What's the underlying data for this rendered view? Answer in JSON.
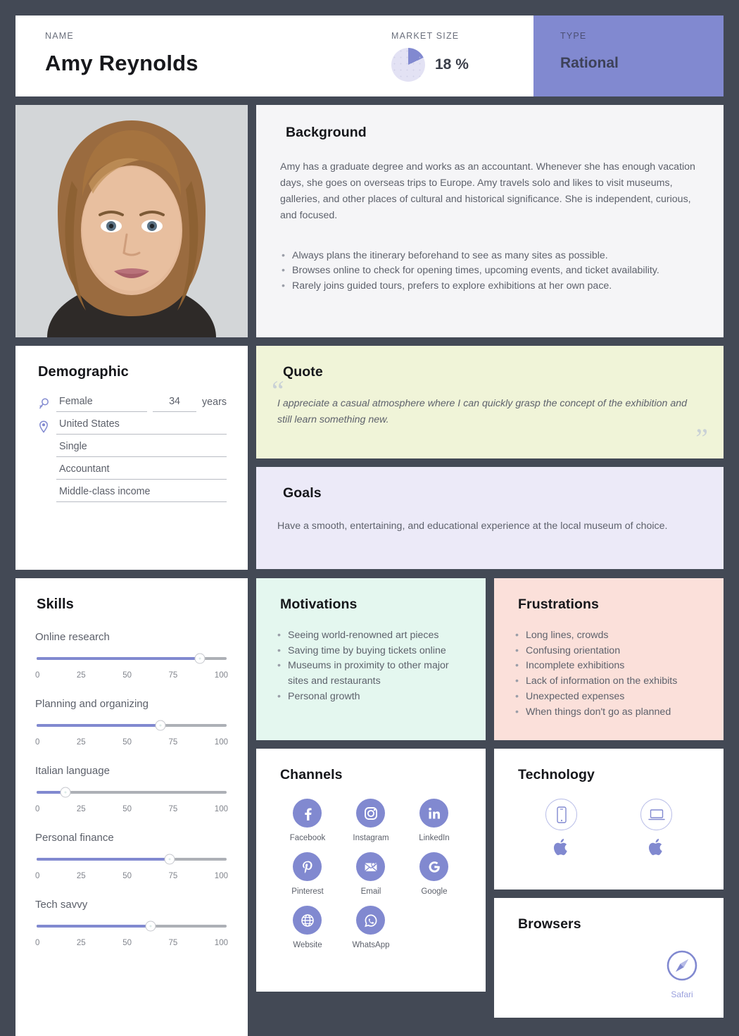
{
  "header": {
    "name_label": "NAME",
    "name": "Amy Reynolds",
    "market_label": "MARKET SIZE",
    "market_value": "18 %",
    "market_pct": 18,
    "type_label": "TYPE",
    "type_value": "Rational",
    "accent": "#8189d0"
  },
  "background": {
    "title": "Background",
    "paragraph": "Amy has a graduate degree and works as an accountant. Whenever she has enough vacation days, she goes on overseas trips to Europe. Amy travels solo and likes to visit museums, galleries, and other places of cultural and historical significance. She is independent, curious, and focused.",
    "bullets": [
      "Always plans the itinerary beforehand to see as many sites as possible.",
      "Browses online to check for opening times, upcoming events, and ticket availability.",
      "Rarely joins guided tours, prefers to explore exhibitions at her own pace."
    ]
  },
  "demographic": {
    "title": "Demographic",
    "gender": "Female",
    "age": "34",
    "age_unit": "years",
    "country": "United States",
    "status": "Single",
    "occupation": "Accountant",
    "income": "Middle-class income"
  },
  "quote": {
    "title": "Quote",
    "text": "I appreciate a casual atmosphere where I can quickly grasp the concept of the exhibition and still learn something new.",
    "open_mark": "“",
    "close_mark": "”"
  },
  "goals": {
    "title": "Goals",
    "text": "Have a smooth, entertaining, and educational experience at the local museum of choice."
  },
  "skills": {
    "title": "Skills",
    "ticks": [
      "0",
      "25",
      "50",
      "75",
      "100"
    ],
    "items": [
      {
        "label": "Online research",
        "value": 86
      },
      {
        "label": "Planning and organizing",
        "value": 65
      },
      {
        "label": "Italian language",
        "value": 15
      },
      {
        "label": "Personal finance",
        "value": 70
      },
      {
        "label": "Tech savvy",
        "value": 60
      }
    ]
  },
  "motivations": {
    "title": "Motivations",
    "items": [
      "Seeing world-renowned art pieces",
      "Saving time by buying tickets online",
      "Museums in proximity to other major sites and restaurants",
      "Personal growth"
    ]
  },
  "frustrations": {
    "title": "Frustrations",
    "items": [
      "Long lines, crowds",
      "Confusing orientation",
      "Incomplete exhibitions",
      "Lack of information on the exhibits",
      "Unexpected expenses",
      "When things don't go as planned"
    ]
  },
  "channels": {
    "title": "Channels",
    "items": [
      {
        "name": "Facebook",
        "icon": "facebook-icon"
      },
      {
        "name": "Instagram",
        "icon": "instagram-icon"
      },
      {
        "name": "LinkedIn",
        "icon": "linkedin-icon"
      },
      {
        "name": "Pinterest",
        "icon": "pinterest-icon"
      },
      {
        "name": "Email",
        "icon": "email-icon"
      },
      {
        "name": "Google",
        "icon": "google-icon"
      },
      {
        "name": "Website",
        "icon": "globe-icon"
      },
      {
        "name": "WhatsApp",
        "icon": "whatsapp-icon"
      }
    ]
  },
  "technology": {
    "title": "Technology",
    "items": [
      {
        "device": "smartphone-icon",
        "os": "apple-icon"
      },
      {
        "device": "laptop-icon",
        "os": "apple-icon"
      }
    ]
  },
  "browsers": {
    "title": "Browsers",
    "items": [
      {
        "name": "Safari",
        "icon": "safari-icon"
      }
    ]
  }
}
